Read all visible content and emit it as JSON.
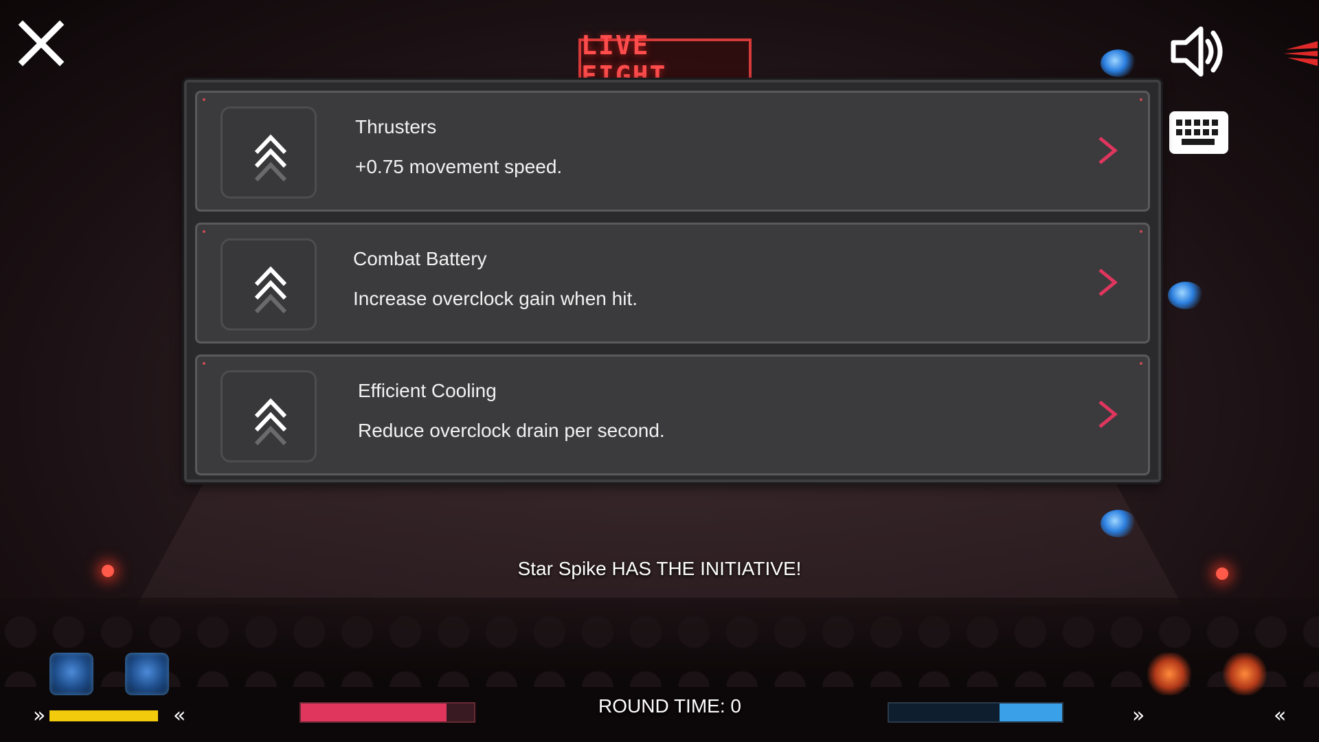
{
  "banner": {
    "text": "LIVE FIGHT"
  },
  "upgrades": [
    {
      "title": "Thrusters",
      "description": "+0.75 movement speed."
    },
    {
      "title": "Combat Battery",
      "description": "Increase overclock gain when hit."
    },
    {
      "title": "Efficient Cooling",
      "description": "Reduce overclock drain per second."
    }
  ],
  "status": {
    "initiative": "Star Spike HAS THE INITIATIVE!",
    "round_time": "ROUND TIME: 0"
  },
  "hud": {
    "player_meter_level": 1.0,
    "player_health_level": 0.84,
    "opponent_energy_level": 0.36,
    "left_arrow_a": "»",
    "left_arrow_b": "«",
    "right_arrow_a": "»",
    "right_arrow_b": "«"
  },
  "icons": {
    "close": "close-icon",
    "sound": "speaker-icon",
    "keyboard": "keyboard-icon",
    "upgrade": "double-chevron-up-icon",
    "select": "chevron-right-icon"
  },
  "colors": {
    "accent_red": "#e0365e",
    "meter_yellow": "#f2cc0c",
    "energy_blue": "#3aa0e8"
  }
}
